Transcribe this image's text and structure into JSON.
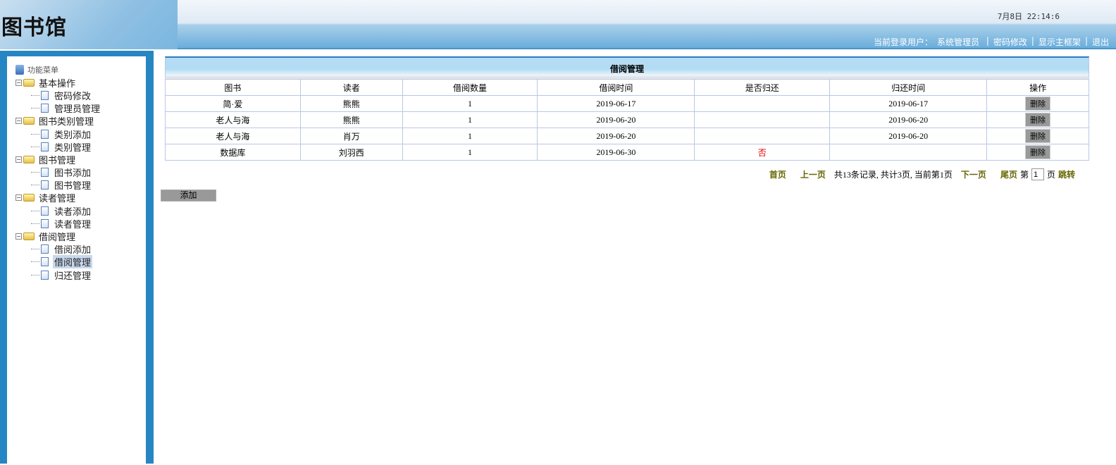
{
  "header": {
    "logo": "图书馆",
    "clock": "7月8日 22:14:6",
    "user_label": "当前登录用户：",
    "user_name": "系统管理员",
    "links": [
      "密码修改",
      "显示主框架",
      "退出"
    ]
  },
  "sidebar": {
    "title": "功能菜单",
    "groups": [
      {
        "label": "基本操作",
        "items": [
          "密码修改",
          "管理员管理"
        ]
      },
      {
        "label": "图书类别管理",
        "items": [
          "类别添加",
          "类别管理"
        ]
      },
      {
        "label": "图书管理",
        "items": [
          "图书添加",
          "图书管理"
        ]
      },
      {
        "label": "读者管理",
        "items": [
          "读者添加",
          "读者管理"
        ]
      },
      {
        "label": "借阅管理",
        "items": [
          "借阅添加",
          "借阅管理",
          "归还管理"
        ]
      }
    ],
    "active": "借阅管理"
  },
  "table": {
    "title": "借阅管理",
    "columns": [
      "图书",
      "读者",
      "借阅数量",
      "借阅时间",
      "是否归还",
      "归还时间",
      "操作"
    ],
    "rows": [
      {
        "book": "简·爱",
        "reader": "熊熊",
        "qty": "1",
        "borrow": "2019-06-17",
        "returned": "",
        "return_date": "2019-06-17",
        "action": "删除"
      },
      {
        "book": "老人与海",
        "reader": "熊熊",
        "qty": "1",
        "borrow": "2019-06-20",
        "returned": "",
        "return_date": "2019-06-20",
        "action": "删除"
      },
      {
        "book": "老人与海",
        "reader": "肖万",
        "qty": "1",
        "borrow": "2019-06-20",
        "returned": "",
        "return_date": "2019-06-20",
        "action": "删除"
      },
      {
        "book": "数据库",
        "reader": "刘羽西",
        "qty": "1",
        "borrow": "2019-06-30",
        "returned": "否",
        "return_date": "",
        "action": "删除"
      }
    ]
  },
  "pager": {
    "first": "首页",
    "prev": "上一页",
    "summary": "共13条记录, 共计3页, 当前第1页",
    "next": "下一页",
    "last": "尾页",
    "page_prefix": "第",
    "page_value": "1",
    "page_suffix": "页",
    "go": "跳转"
  },
  "add_button": "添加",
  "colors": {
    "sidebar_bg": "#2686c4",
    "link": "#666600",
    "no": "#e00000"
  }
}
